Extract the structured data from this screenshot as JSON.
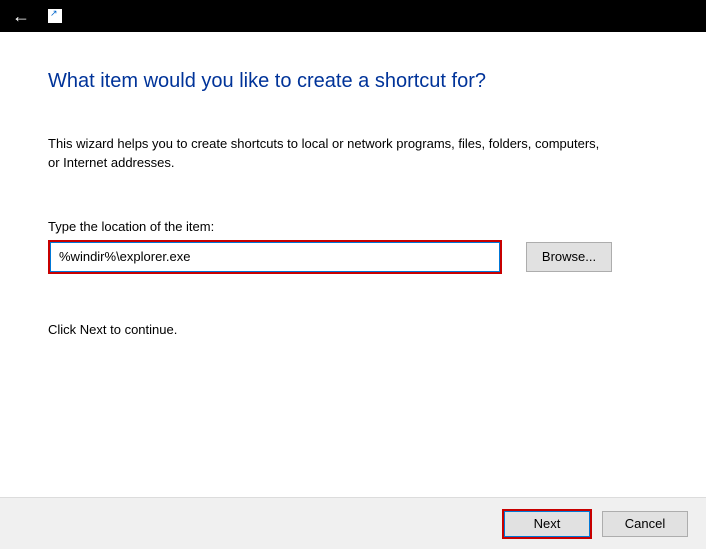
{
  "titlebar": {
    "back_icon": "←"
  },
  "heading": "What item would you like to create a shortcut for?",
  "description": "This wizard helps you to create shortcuts to local or network programs, files, folders, computers, or Internet addresses.",
  "location": {
    "label": "Type the location of the item:",
    "value": "%windir%\\explorer.exe",
    "browse_label": "Browse..."
  },
  "continue_text": "Click Next to continue.",
  "footer": {
    "next_label": "Next",
    "cancel_label": "Cancel"
  }
}
